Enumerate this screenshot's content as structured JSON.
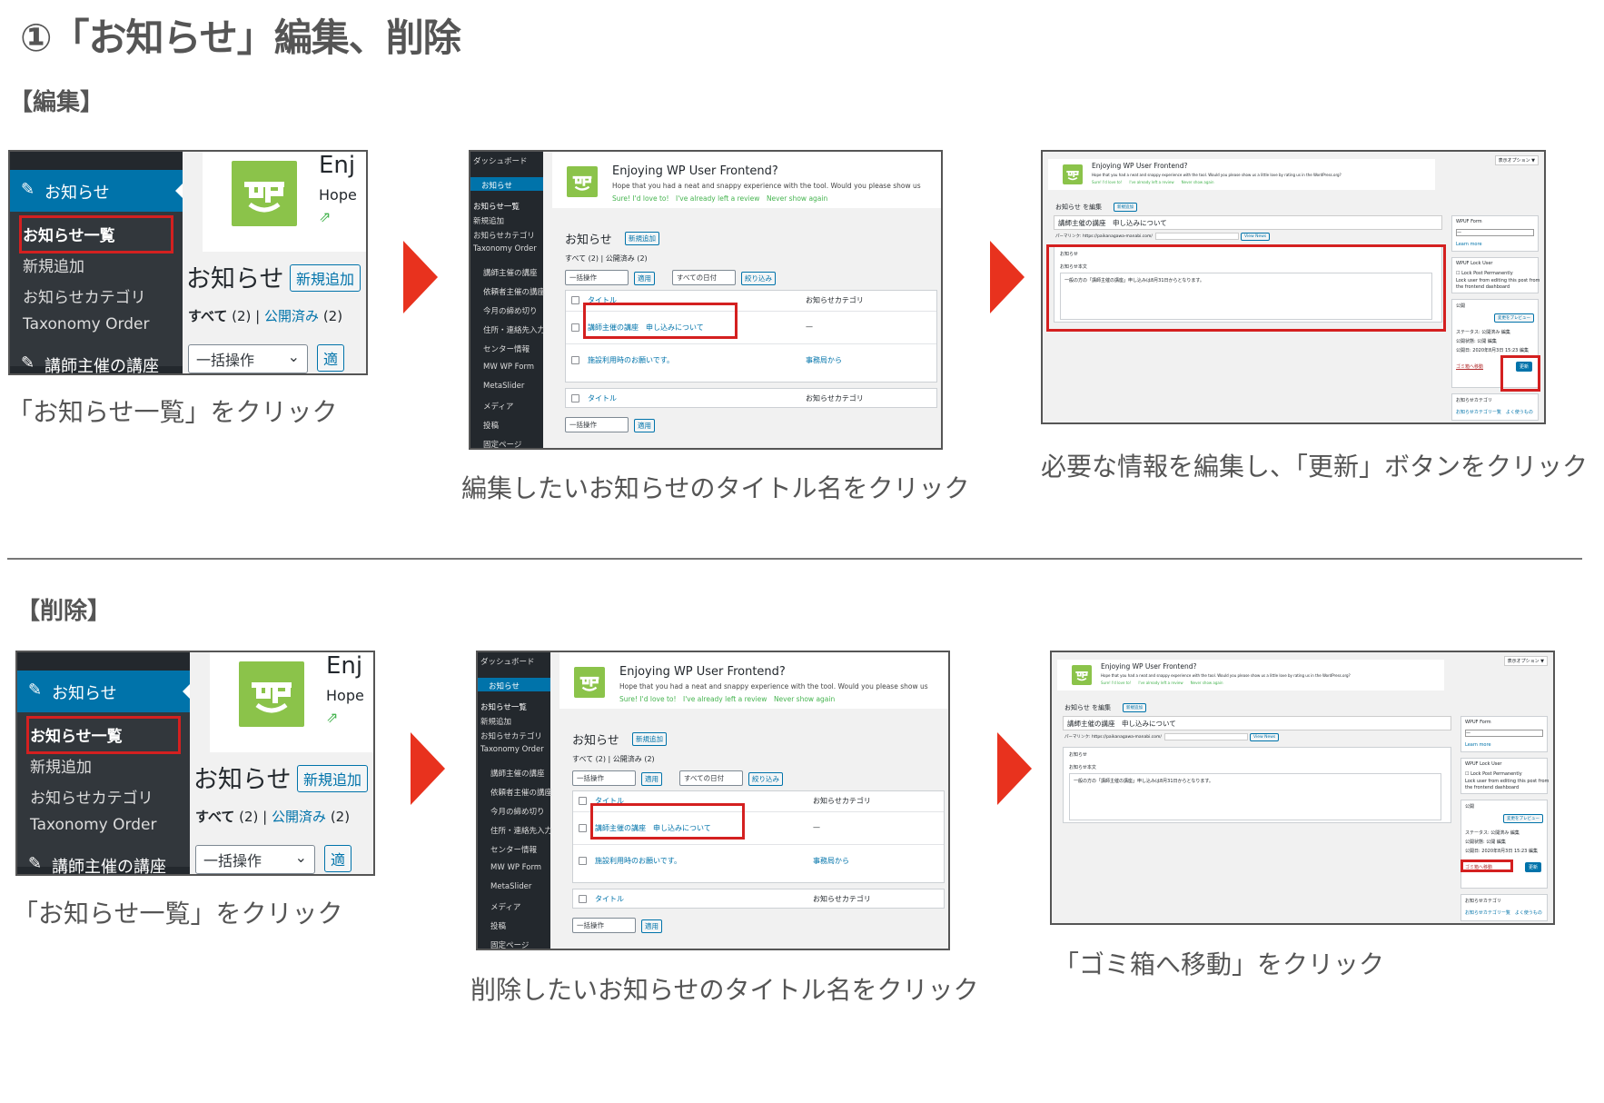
{
  "page": {
    "title": "①「お知らせ」編集、削除",
    "edit_heading": "【編集】",
    "delete_heading": "【削除】"
  },
  "captions": {
    "edit_step1": "「お知らせ一覧」をクリック",
    "edit_step2": "編集したいお知らせのタイトル名をクリック",
    "edit_step3": "必要な情報を編集し、「更新」ボタンをクリック",
    "delete_step1": "「お知らせ一覧」をクリック",
    "delete_step2": "削除したいお知らせのタイトル名をクリック",
    "delete_step3": "「ゴミ箱へ移動」をクリック"
  },
  "zoom_shot": {
    "menu_active": "お知らせ",
    "sub_items": [
      "お知らせ一覧",
      "新規追加",
      "お知らせカテゴリ",
      "Taxonomy Order"
    ],
    "menu_next": "講師主催の講座",
    "notice_title": "Enj",
    "notice_sub": "Hope",
    "page_heading": "お知らせ",
    "add_new": "新規追加",
    "filter_all": "すべて",
    "filter_all_count": "(2)",
    "filter_sep": "|",
    "filter_published": "公開済み",
    "filter_published_count": "(2)",
    "bulk_action": "一括操作",
    "apply": "適"
  },
  "list_shot": {
    "sidebar": [
      "ダッシュボード",
      "お知らせ",
      "お知らせ一覧",
      "新規追加",
      "お知らせカテゴリ",
      "Taxonomy Order",
      "講師主催の講座",
      "依頼者主催の講座",
      "今月の締め切り",
      "住所・連絡先入力",
      "センター情報",
      "MW WP Form",
      "MetaSlider",
      "メディア",
      "投稿",
      "固定ページ"
    ],
    "notice_title": "Enjoying WP User Frontend?",
    "notice_sub": "Hope that you had a neat and snappy experience with the tool. Would you please show us",
    "notice_link1": "Sure! I'd love to!",
    "notice_link2": "I've already left a review",
    "notice_link3": "Never show again",
    "heading": "お知らせ",
    "add_new": "新規追加",
    "filter": "すべて (2) | 公開済み (2)",
    "bulk_action": "一括操作",
    "apply": "適用",
    "date_filter": "すべての日付",
    "filter_btn": "絞り込み",
    "col_title": "タイトル",
    "col_category": "お知らせカテゴリ",
    "row1_title": "講師主催の講座　申し込みについて",
    "row1_cat": "—",
    "row2_title": "施設利用時のお願いです。",
    "row2_cat": "事務局から"
  },
  "edit_shot": {
    "screen_options": "表示オプション ▼",
    "notice_title": "Enjoying WP User Frontend?",
    "notice_sub": "Hope that you had a neat and snappy experience with the tool. Would you please show us a little love by rating us in the WordPress.org?",
    "notice_links": "Sure! I'd love to!　　I've already left a review　　Never show again",
    "heading": "お知らせ を編集",
    "add_new": "新規追加",
    "post_title": "講師主催の講座　申し込みについて",
    "permalink": "パーマリンク: https://paikanagawa-manabi.com/",
    "view_news": "View News",
    "box_label": "お知らせ",
    "body_label": "お知らせ本文",
    "body_text": "一般の方の「講師主催の講座」申し込みは8月31日からとなります。",
    "wpuf_form": "WPUF Form",
    "wpuf_select": "—",
    "learn_more": "Learn more",
    "wpuf_lock": "WPUF Lock User",
    "lock_perm": "Lock Post Permanently",
    "lock_desc1": "Lock user from editing this post from",
    "lock_desc2": "the frontend dashboard",
    "publish": "公開",
    "preview": "変更をプレビュー",
    "status": "ステータス: 公開済み 編集",
    "visibility": "公開状態: 公開 編集",
    "published_on": "公開日: 2020年8月3日 15:23 編集",
    "trash": "ゴミ箱へ移動",
    "update": "更新",
    "category_box": "お知らせカテゴリ",
    "category_links": "お知らせカテゴリー覧　よく使うもの"
  }
}
